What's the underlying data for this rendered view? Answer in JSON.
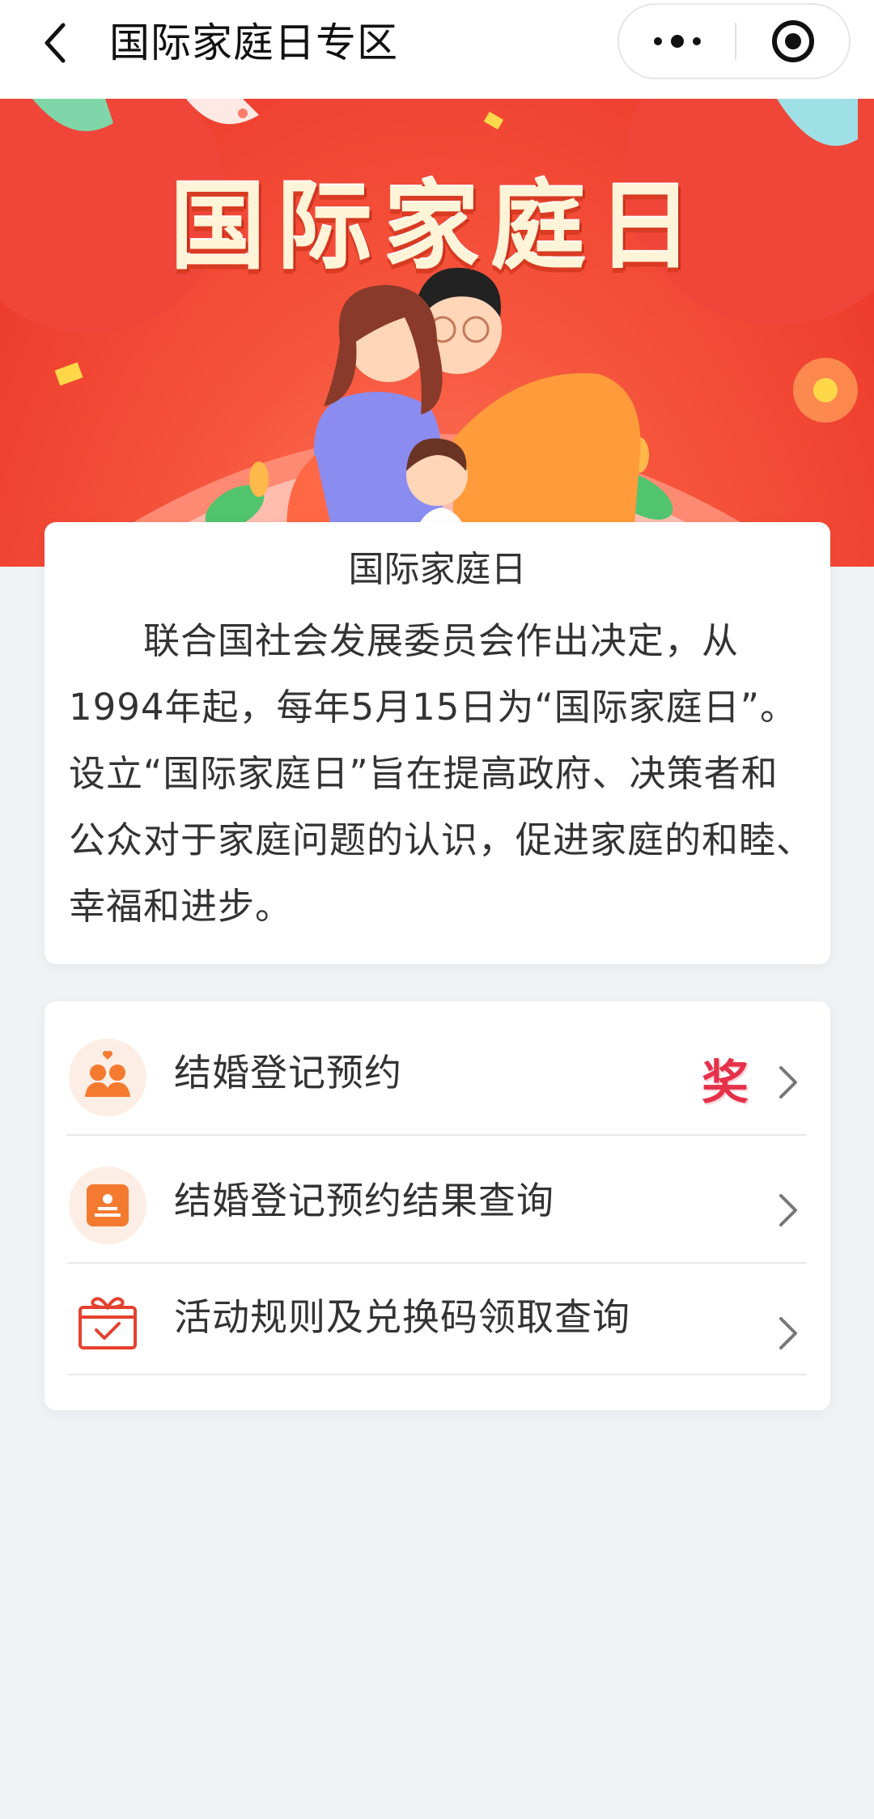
{
  "nav": {
    "title": "国际家庭日专区"
  },
  "banner": {
    "title": "国际家庭日"
  },
  "intro": {
    "title": "国际家庭日",
    "text": "联合国社会发展委员会作出决定，从1994年起，每年5月15日为“国际家庭日”。设立“国际家庭日”旨在提高政府、决策者和公众对于家庭问题的认识，促进家庭的和睦、幸福和进步。"
  },
  "menu": {
    "items": [
      {
        "label": "结婚登记预约",
        "icon": "couple-icon",
        "badge": "奖"
      },
      {
        "label": "结婚登记预约结果查询",
        "icon": "certificate-icon"
      },
      {
        "label": "活动规则及兑换码领取查询",
        "icon": "gift-box-icon"
      }
    ]
  },
  "colors": {
    "accent_orange": "#f47a2f",
    "banner_red": "#ea3327",
    "prize_red": "#e5314a"
  }
}
